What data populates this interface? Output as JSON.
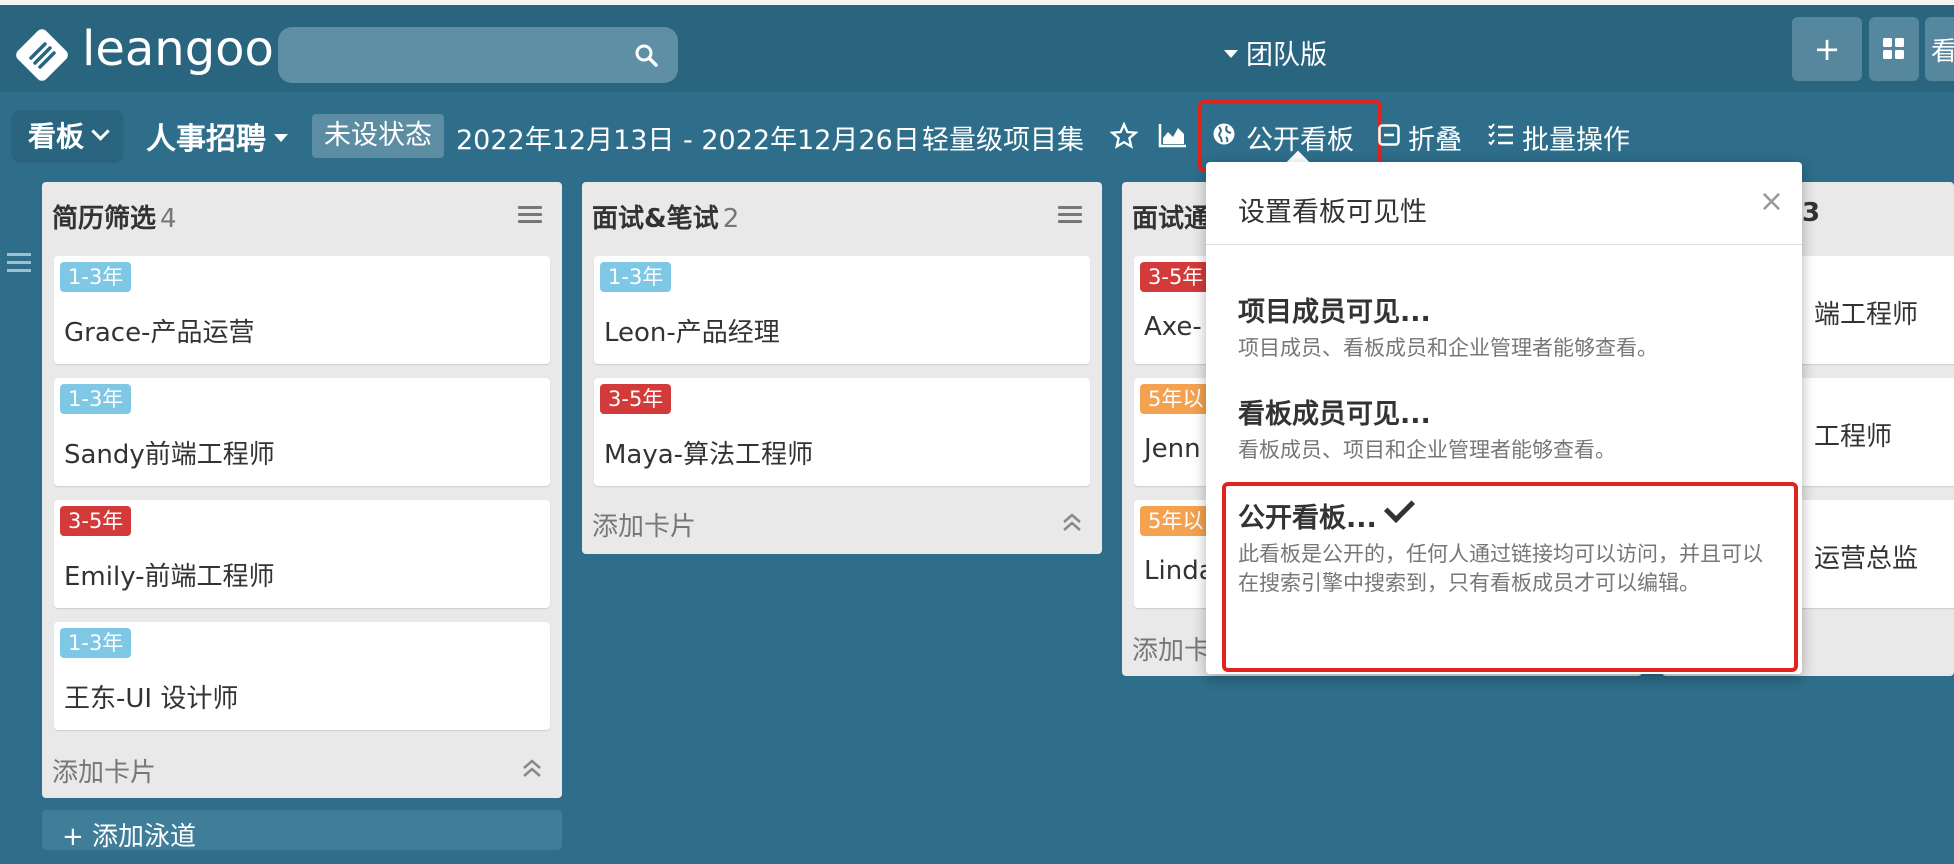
{
  "topbar": {
    "logo_text": "leangoo",
    "edition": "团队版",
    "add_button": "+",
    "more_label": "看"
  },
  "board_header": {
    "view_label": "看板",
    "board_title": "人事招聘",
    "status": "未设状态",
    "date_range": "2022年12月13日 - 2022年12月26日",
    "project": "轻量级项目集",
    "visibility_label": "公开看板",
    "fold_label": "折叠",
    "batch_label": "批量操作"
  },
  "lists": [
    {
      "title": "简历筛选",
      "count": "4",
      "cards": [
        {
          "tag": "1-3年",
          "tag_color": "#7ec8e6",
          "title": "Grace-产品运营"
        },
        {
          "tag": "1-3年",
          "tag_color": "#7ec8e6",
          "title": "Sandy前端工程师"
        },
        {
          "tag": "3-5年",
          "tag_color": "#d33a3a",
          "title": "Emily-前端工程师"
        },
        {
          "tag": "1-3年",
          "tag_color": "#7ec8e6",
          "title": "王东-UI 设计师"
        }
      ],
      "add_card": "添加卡片"
    },
    {
      "title": "面试&笔试",
      "count": "2",
      "cards": [
        {
          "tag": "1-3年",
          "tag_color": "#7ec8e6",
          "title": "Leon-产品经理"
        },
        {
          "tag": "3-5年",
          "tag_color": "#d33a3a",
          "title": "Maya-算法工程师"
        }
      ],
      "add_card": "添加卡片"
    },
    {
      "title": "面试通",
      "cards": [
        {
          "tag": "3-5年",
          "tag_color": "#d33a3a",
          "title": "Axe-"
        },
        {
          "tag": "5年以",
          "tag_color": "#f4a250",
          "title": "Jenn"
        },
        {
          "tag": "5年以",
          "tag_color": "#f4a250",
          "title": "Linda"
        }
      ],
      "add_card": "添加卡"
    },
    {
      "title_partial": "3",
      "cards": [
        {
          "title": "端工程师"
        },
        {
          "title": "工程师"
        },
        {
          "title": "运营总监"
        }
      ]
    }
  ],
  "add_lane": "+ 添加泳道",
  "popover": {
    "title": "设置看板可见性",
    "close": "×",
    "options": [
      {
        "title": "项目成员可见...",
        "desc": "项目成员、看板成员和企业管理者能够查看。",
        "selected": false
      },
      {
        "title": "看板成员可见...",
        "desc": "看板成员、项目和企业管理者能够查看。",
        "selected": false
      },
      {
        "title": "公开看板...",
        "desc": "此看板是公开的，任何人通过链接均可以访问，并且可以在搜索引擎中搜索到，只有看板成员才可以编辑。",
        "selected": true
      }
    ]
  },
  "colors": {
    "background": "#2e6e8a",
    "topbar": "#2a6580",
    "highlight": "#e0231c",
    "list_bg": "#e9e9e9"
  }
}
